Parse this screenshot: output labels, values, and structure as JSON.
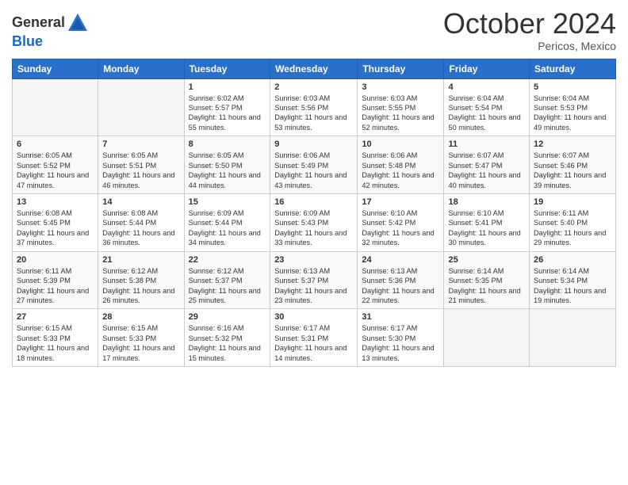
{
  "header": {
    "logo_general": "General",
    "logo_blue": "Blue",
    "month": "October 2024",
    "location": "Pericos, Mexico"
  },
  "weekdays": [
    "Sunday",
    "Monday",
    "Tuesday",
    "Wednesday",
    "Thursday",
    "Friday",
    "Saturday"
  ],
  "weeks": [
    [
      {
        "day": "",
        "empty": true
      },
      {
        "day": "",
        "empty": true
      },
      {
        "day": "1",
        "sunrise": "6:02 AM",
        "sunset": "5:57 PM",
        "daylight": "11 hours and 55 minutes."
      },
      {
        "day": "2",
        "sunrise": "6:03 AM",
        "sunset": "5:56 PM",
        "daylight": "11 hours and 53 minutes."
      },
      {
        "day": "3",
        "sunrise": "6:03 AM",
        "sunset": "5:55 PM",
        "daylight": "11 hours and 52 minutes."
      },
      {
        "day": "4",
        "sunrise": "6:04 AM",
        "sunset": "5:54 PM",
        "daylight": "11 hours and 50 minutes."
      },
      {
        "day": "5",
        "sunrise": "6:04 AM",
        "sunset": "5:53 PM",
        "daylight": "11 hours and 49 minutes."
      }
    ],
    [
      {
        "day": "6",
        "sunrise": "6:05 AM",
        "sunset": "5:52 PM",
        "daylight": "11 hours and 47 minutes."
      },
      {
        "day": "7",
        "sunrise": "6:05 AM",
        "sunset": "5:51 PM",
        "daylight": "11 hours and 46 minutes."
      },
      {
        "day": "8",
        "sunrise": "6:05 AM",
        "sunset": "5:50 PM",
        "daylight": "11 hours and 44 minutes."
      },
      {
        "day": "9",
        "sunrise": "6:06 AM",
        "sunset": "5:49 PM",
        "daylight": "11 hours and 43 minutes."
      },
      {
        "day": "10",
        "sunrise": "6:06 AM",
        "sunset": "5:48 PM",
        "daylight": "11 hours and 42 minutes."
      },
      {
        "day": "11",
        "sunrise": "6:07 AM",
        "sunset": "5:47 PM",
        "daylight": "11 hours and 40 minutes."
      },
      {
        "day": "12",
        "sunrise": "6:07 AM",
        "sunset": "5:46 PM",
        "daylight": "11 hours and 39 minutes."
      }
    ],
    [
      {
        "day": "13",
        "sunrise": "6:08 AM",
        "sunset": "5:45 PM",
        "daylight": "11 hours and 37 minutes."
      },
      {
        "day": "14",
        "sunrise": "6:08 AM",
        "sunset": "5:44 PM",
        "daylight": "11 hours and 36 minutes."
      },
      {
        "day": "15",
        "sunrise": "6:09 AM",
        "sunset": "5:44 PM",
        "daylight": "11 hours and 34 minutes."
      },
      {
        "day": "16",
        "sunrise": "6:09 AM",
        "sunset": "5:43 PM",
        "daylight": "11 hours and 33 minutes."
      },
      {
        "day": "17",
        "sunrise": "6:10 AM",
        "sunset": "5:42 PM",
        "daylight": "11 hours and 32 minutes."
      },
      {
        "day": "18",
        "sunrise": "6:10 AM",
        "sunset": "5:41 PM",
        "daylight": "11 hours and 30 minutes."
      },
      {
        "day": "19",
        "sunrise": "6:11 AM",
        "sunset": "5:40 PM",
        "daylight": "11 hours and 29 minutes."
      }
    ],
    [
      {
        "day": "20",
        "sunrise": "6:11 AM",
        "sunset": "5:39 PM",
        "daylight": "11 hours and 27 minutes."
      },
      {
        "day": "21",
        "sunrise": "6:12 AM",
        "sunset": "5:38 PM",
        "daylight": "11 hours and 26 minutes."
      },
      {
        "day": "22",
        "sunrise": "6:12 AM",
        "sunset": "5:37 PM",
        "daylight": "11 hours and 25 minutes."
      },
      {
        "day": "23",
        "sunrise": "6:13 AM",
        "sunset": "5:37 PM",
        "daylight": "11 hours and 23 minutes."
      },
      {
        "day": "24",
        "sunrise": "6:13 AM",
        "sunset": "5:36 PM",
        "daylight": "11 hours and 22 minutes."
      },
      {
        "day": "25",
        "sunrise": "6:14 AM",
        "sunset": "5:35 PM",
        "daylight": "11 hours and 21 minutes."
      },
      {
        "day": "26",
        "sunrise": "6:14 AM",
        "sunset": "5:34 PM",
        "daylight": "11 hours and 19 minutes."
      }
    ],
    [
      {
        "day": "27",
        "sunrise": "6:15 AM",
        "sunset": "5:33 PM",
        "daylight": "11 hours and 18 minutes."
      },
      {
        "day": "28",
        "sunrise": "6:15 AM",
        "sunset": "5:33 PM",
        "daylight": "11 hours and 17 minutes."
      },
      {
        "day": "29",
        "sunrise": "6:16 AM",
        "sunset": "5:32 PM",
        "daylight": "11 hours and 15 minutes."
      },
      {
        "day": "30",
        "sunrise": "6:17 AM",
        "sunset": "5:31 PM",
        "daylight": "11 hours and 14 minutes."
      },
      {
        "day": "31",
        "sunrise": "6:17 AM",
        "sunset": "5:30 PM",
        "daylight": "11 hours and 13 minutes."
      },
      {
        "day": "",
        "empty": true
      },
      {
        "day": "",
        "empty": true
      }
    ]
  ],
  "labels": {
    "sunrise": "Sunrise: ",
    "sunset": "Sunset: ",
    "daylight": "Daylight: "
  }
}
